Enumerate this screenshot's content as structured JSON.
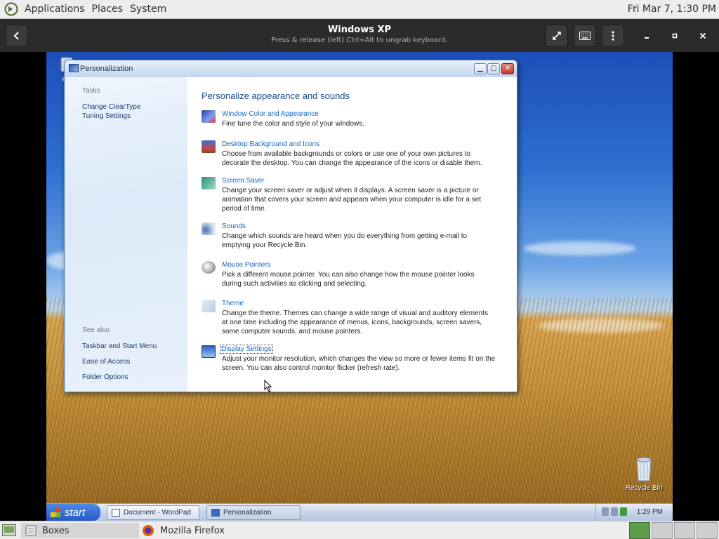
{
  "top_panel": {
    "menus": [
      "Applications",
      "Places",
      "System"
    ],
    "clock": "Fri Mar  7,  1:30 PM",
    "logo_icon": "gnome-foot-icon"
  },
  "boxes_header": {
    "title": "Windows XP",
    "subtitle": "Press & release (left) Ctrl+Alt to ungrab keyboard.",
    "back_icon": "back-arrow-icon",
    "fullscreen_icon": "fullscreen-icon",
    "keyboard_icon": "keyboard-icon",
    "menu_icon": "kebab-menu-icon"
  },
  "desktop": {
    "icons": [
      {
        "label": "Re",
        "name": "recycle-bin-partial-icon"
      },
      {
        "label": "Recycle Bin",
        "name": "recycle-bin-icon"
      }
    ]
  },
  "window": {
    "title": "Personalization",
    "left_pane": {
      "tasks_heading": "Tasks",
      "task_links": [
        "Change ClearType",
        "Tuning Settings"
      ],
      "see_also_heading": "See also",
      "see_also_links": [
        "Taskbar and Start Menu",
        "Ease of Access",
        "Folder Options"
      ]
    },
    "main": {
      "heading": "Personalize appearance and sounds",
      "items": [
        {
          "link": "Window Color and Appearance",
          "description": "Fine tune the color and style of your windows.",
          "icon": "window-color-icon"
        },
        {
          "link": "Desktop Background and Icons",
          "description": "Choose from available backgrounds or colors or use one of your own pictures to decorate the desktop. You can change the appearance of the icons or disable them.",
          "icon": "desktop-background-icon"
        },
        {
          "link": "Screen Saver",
          "description": "Change your screen saver or adjust when it displays. A screen saver is a picture or animation that covers your screen and appears when your computer is idle for a set period of time.",
          "icon": "screen-saver-icon"
        },
        {
          "link": "Sounds",
          "description": "Change which sounds are heard when you do everything from getting e-mail to emptying your Recycle Bin.",
          "icon": "sounds-icon"
        },
        {
          "link": "Mouse Pointers",
          "description": "Pick a different mouse pointer. You can also change how the mouse pointer looks during such activities as clicking and selecting.",
          "icon": "mouse-pointer-icon"
        },
        {
          "link": "Theme",
          "description": "Change the theme. Themes can change a wide range of visual and auditory elements at one time including the appearance of menus, icons, backgrounds, screen savers, some computer sounds, and mouse pointers.",
          "icon": "theme-icon"
        },
        {
          "link": "Display Settings",
          "description": "Adjust your monitor resolution, which changes the view so more or fewer items fit on the screen. You can also control monitor flicker (refresh rate).",
          "icon": "display-settings-icon"
        }
      ]
    }
  },
  "xp_taskbar": {
    "start_label": "start",
    "tasks": [
      {
        "label": "Document - WordPad",
        "active": false
      },
      {
        "label": "Personalization",
        "active": true
      }
    ],
    "clock": "1:29 PM"
  },
  "bottom_panel": {
    "tasks": [
      {
        "label": "Boxes",
        "icon": "boxes-app-icon",
        "active": true
      },
      {
        "label": "Mozilla Firefox",
        "icon": "firefox-icon",
        "active": false
      }
    ]
  },
  "colors": {
    "link": "#1565c0",
    "heading": "#1b4b8a",
    "boxes_header_bg": "#2b2b2b",
    "panel_bg": "#ededed"
  }
}
